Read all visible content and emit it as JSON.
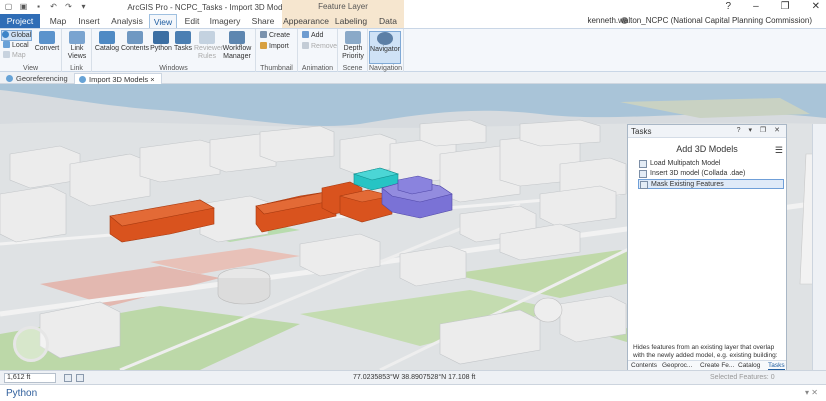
{
  "window": {
    "title": "ArcGIS Pro - NCPC_Tasks - Import 3D Models",
    "context_group": "Feature Layer",
    "user": "kenneth.walton_NCPC (National Capital Planning Commission)",
    "controls": [
      "?",
      "–",
      "❐",
      "✕"
    ]
  },
  "tabs": [
    "Project",
    "Map",
    "Insert",
    "Analysis",
    "View",
    "Edit",
    "Imagery",
    "Share",
    "Appearance",
    "Labeling",
    "Data"
  ],
  "ribbon": {
    "view": {
      "global": "Global",
      "local": "Local",
      "map": "Map",
      "convert": "Convert",
      "label": "View"
    },
    "link": {
      "link_views": "Link Views",
      "label": "Link"
    },
    "windows": {
      "catalog": "Catalog",
      "contents": "Contents",
      "python": "Python",
      "tasks": "Tasks",
      "reviewer_rules": "Reviewer Rules",
      "workflow_manager": "Workflow Manager",
      "label": "Windows"
    },
    "thumbnail": {
      "create": "Create",
      "import": "Import",
      "label": "Thumbnail"
    },
    "animation": {
      "add": "Add",
      "remove": "Remove",
      "label": "Animation"
    },
    "scene": {
      "depth_priority": "Depth Priority",
      "label": "Scene"
    },
    "navigation": {
      "navigator": "Navigator",
      "label": "Navigation"
    }
  },
  "doc_tabs": [
    {
      "label": "Georeferencing",
      "close": ""
    },
    {
      "label": "Import 3D Models",
      "close": "×"
    }
  ],
  "tasks": {
    "pane_title": "Tasks",
    "controls": "? ▾ ❐ ✕",
    "title": "Add 3D Models",
    "menu": "☰",
    "items": [
      "Load Multipatch Model",
      "Insert 3D model (Collada .dae)",
      "Mask Existing Features"
    ],
    "description": "Hides features from an existing layer that overlap with the newly added model, e.g. existing building:",
    "bottom_tabs": [
      "Contents",
      "Geoproc...",
      "Create Fe...",
      "Catalog",
      "Tasks"
    ]
  },
  "status": {
    "scale": "1,612 ft",
    "coords": "77.0235853°W 38.8907528°N   17.108 ft",
    "selected": "Selected Features: 0"
  },
  "python": {
    "title": "Python",
    "controls": "▾ ✕"
  },
  "colors": {
    "project_tab": "#2f6db6",
    "building_orange": "#d9531e",
    "building_cyan": "#26c4c4",
    "building_purple": "#7a72d6",
    "water": "#a9c4d8",
    "park": "#b8d6a4"
  }
}
